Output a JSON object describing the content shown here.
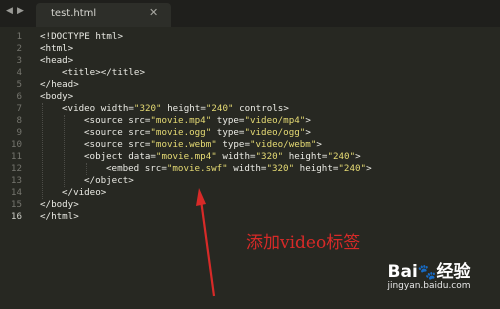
{
  "tabbar": {
    "prev_icon": "◀",
    "next_icon": "▶",
    "tab_title": "test.html",
    "close_icon": "✕"
  },
  "colors": {
    "background": "#272822",
    "string": "#e6db74",
    "annotation": "#d72a28",
    "line_number": "#76766f"
  },
  "lines": [
    {
      "n": "1",
      "indent": 0,
      "parts": [
        {
          "t": "<!DOCTYPE html>",
          "c": "tag"
        }
      ]
    },
    {
      "n": "2",
      "indent": 0,
      "parts": [
        {
          "t": "<html>",
          "c": "tag"
        }
      ]
    },
    {
      "n": "3",
      "indent": 0,
      "parts": [
        {
          "t": "<head>",
          "c": "tag"
        }
      ]
    },
    {
      "n": "4",
      "indent": 1,
      "parts": [
        {
          "t": "<title></title>",
          "c": "tag"
        }
      ]
    },
    {
      "n": "5",
      "indent": 0,
      "parts": [
        {
          "t": "</head>",
          "c": "tag"
        }
      ]
    },
    {
      "n": "6",
      "indent": 0,
      "parts": [
        {
          "t": "<body>",
          "c": "tag"
        }
      ]
    },
    {
      "n": "7",
      "indent": 1,
      "parts": [
        {
          "t": "<video width=",
          "c": "tag"
        },
        {
          "t": "\"320\"",
          "c": "str"
        },
        {
          "t": " height=",
          "c": "tag"
        },
        {
          "t": "\"240\"",
          "c": "str"
        },
        {
          "t": " controls>",
          "c": "tag"
        }
      ]
    },
    {
      "n": "8",
      "indent": 2,
      "parts": [
        {
          "t": "<source src=",
          "c": "tag"
        },
        {
          "t": "\"movie.mp4\"",
          "c": "str"
        },
        {
          "t": " type=",
          "c": "tag"
        },
        {
          "t": "\"video/mp4\"",
          "c": "str"
        },
        {
          "t": ">",
          "c": "tag"
        }
      ]
    },
    {
      "n": "9",
      "indent": 2,
      "parts": [
        {
          "t": "<source src=",
          "c": "tag"
        },
        {
          "t": "\"movie.ogg\"",
          "c": "str"
        },
        {
          "t": " type=",
          "c": "tag"
        },
        {
          "t": "\"video/ogg\"",
          "c": "str"
        },
        {
          "t": ">",
          "c": "tag"
        }
      ]
    },
    {
      "n": "10",
      "indent": 2,
      "parts": [
        {
          "t": "<source src=",
          "c": "tag"
        },
        {
          "t": "\"movie.webm\"",
          "c": "str"
        },
        {
          "t": " type=",
          "c": "tag"
        },
        {
          "t": "\"video/webm\"",
          "c": "str"
        },
        {
          "t": ">",
          "c": "tag"
        }
      ]
    },
    {
      "n": "11",
      "indent": 2,
      "parts": [
        {
          "t": "<object data=",
          "c": "tag"
        },
        {
          "t": "\"movie.mp4\"",
          "c": "str"
        },
        {
          "t": " width=",
          "c": "tag"
        },
        {
          "t": "\"320\"",
          "c": "str"
        },
        {
          "t": " height=",
          "c": "tag"
        },
        {
          "t": "\"240\"",
          "c": "str"
        },
        {
          "t": ">",
          "c": "tag"
        }
      ]
    },
    {
      "n": "12",
      "indent": 3,
      "parts": [
        {
          "t": "<embed src=",
          "c": "tag"
        },
        {
          "t": "\"movie.swf\"",
          "c": "str"
        },
        {
          "t": " width=",
          "c": "tag"
        },
        {
          "t": "\"320\"",
          "c": "str"
        },
        {
          "t": " height=",
          "c": "tag"
        },
        {
          "t": "\"240\"",
          "c": "str"
        },
        {
          "t": ">",
          "c": "tag"
        }
      ]
    },
    {
      "n": "13",
      "indent": 2,
      "parts": [
        {
          "t": "</object>",
          "c": "tag"
        }
      ]
    },
    {
      "n": "14",
      "indent": 1,
      "parts": [
        {
          "t": "</video>",
          "c": "tag"
        }
      ]
    },
    {
      "n": "15",
      "indent": 0,
      "parts": [
        {
          "t": "</body>",
          "c": "tag"
        }
      ]
    },
    {
      "n": "16",
      "indent": 0,
      "parts": [
        {
          "t": "</html>",
          "c": "tag"
        }
      ],
      "current": true
    }
  ],
  "annotation": {
    "text": "添加video标签"
  },
  "watermark": {
    "logo_text": "Bai",
    "logo_paw": "🐾",
    "logo_suffix": "经验",
    "url": "jingyan.baidu.com"
  }
}
